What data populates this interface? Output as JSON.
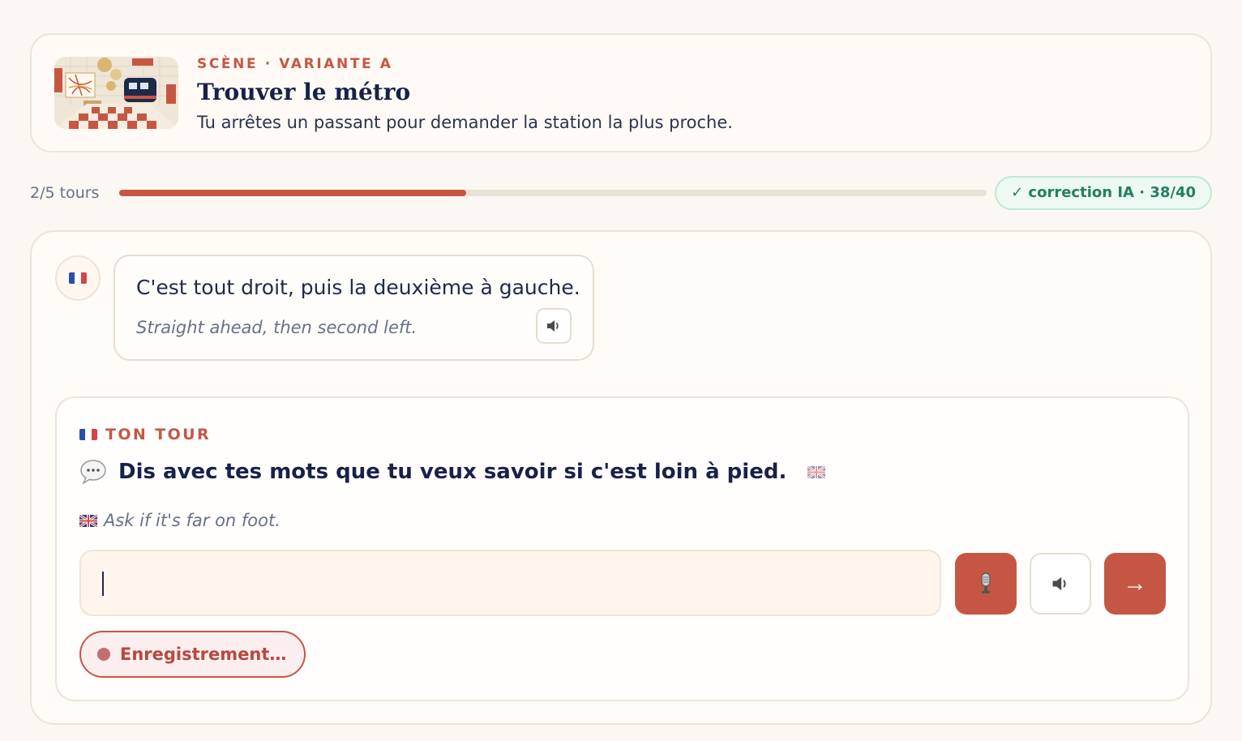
{
  "scene": {
    "label": "SCÈNE · VARIANTE A",
    "title": "Trouver le métro",
    "description": "Tu arrêtes un passant pour demander la station la plus proche."
  },
  "progress": {
    "label": "2/5 tours",
    "current": 2,
    "total": 5
  },
  "correction_badge": "✓ correction IA · 38/40",
  "npc_message": {
    "french": "C'est tout droit, puis la deuxième à gauche.",
    "english": "Straight ahead, then second left."
  },
  "turn": {
    "label": "TON TOUR",
    "prompt": "Dis avec tes mots que tu veux savoir si c'est loin à pied.",
    "hint": "Ask if it's far on foot."
  },
  "input": {
    "value": "",
    "placeholder": ""
  },
  "send_button": "→",
  "recording_status": "Enregistrement…",
  "icons": {
    "speaker_avatar": "france-flag-icon",
    "bubble_audio": "speaker-icon",
    "prompt": "speech-bubble-icon",
    "prompt_translate": "uk-flag-icon",
    "mic": "microphone-icon",
    "speak": "speaker-icon"
  },
  "colors": {
    "accent": "#c65644",
    "success": "#22805b",
    "text": "#17224a",
    "muted": "#66708a"
  }
}
